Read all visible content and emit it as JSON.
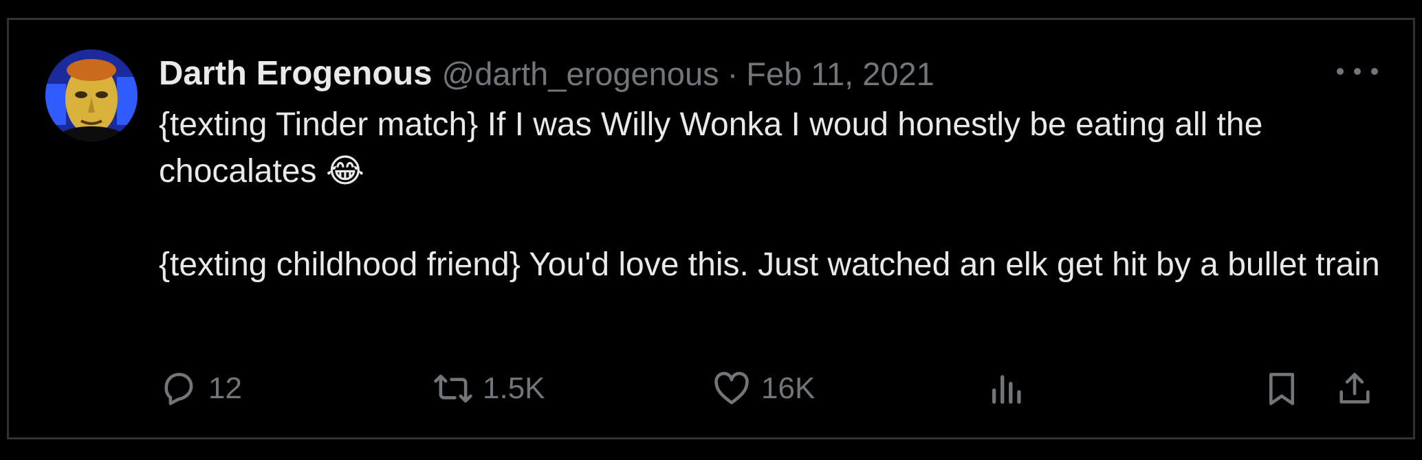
{
  "tweet": {
    "author_name": "Darth Erogenous",
    "handle": "@darth_erogenous",
    "separator": "·",
    "date": "Feb 11, 2021",
    "text": "{texting Tinder match} If I was Willy Wonka I woud honestly be eating all the chocalates 😂\n\n{texting childhood friend} You'd love this. Just watched an elk get hit by a bullet train"
  },
  "actions": {
    "replies": "12",
    "retweets": "1.5K",
    "likes": "16K"
  },
  "colors": {
    "background": "#000000",
    "text": "#e7e9ea",
    "secondary": "#71767b",
    "border": "#2f3336",
    "avatar_bg": "#1b2a9c"
  },
  "icons": [
    "reply-icon",
    "retweet-icon",
    "like-icon",
    "views-icon",
    "bookmark-icon",
    "share-icon",
    "more-icon"
  ]
}
